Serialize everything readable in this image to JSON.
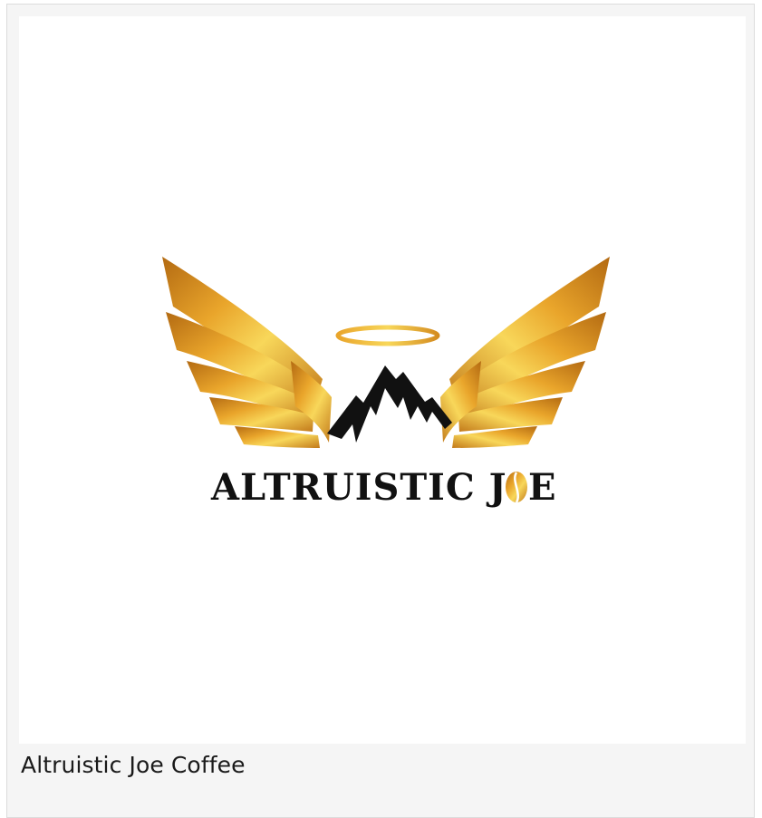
{
  "card": {
    "caption": "Altruistic Joe Coffee"
  },
  "logo": {
    "text": "ALTRUISTIC JOE",
    "colors": {
      "gold_light": "#f8d75a",
      "gold_mid": "#e9a52b",
      "gold_dark": "#b36a12",
      "mountain": "#111111",
      "text": "#111111"
    }
  }
}
